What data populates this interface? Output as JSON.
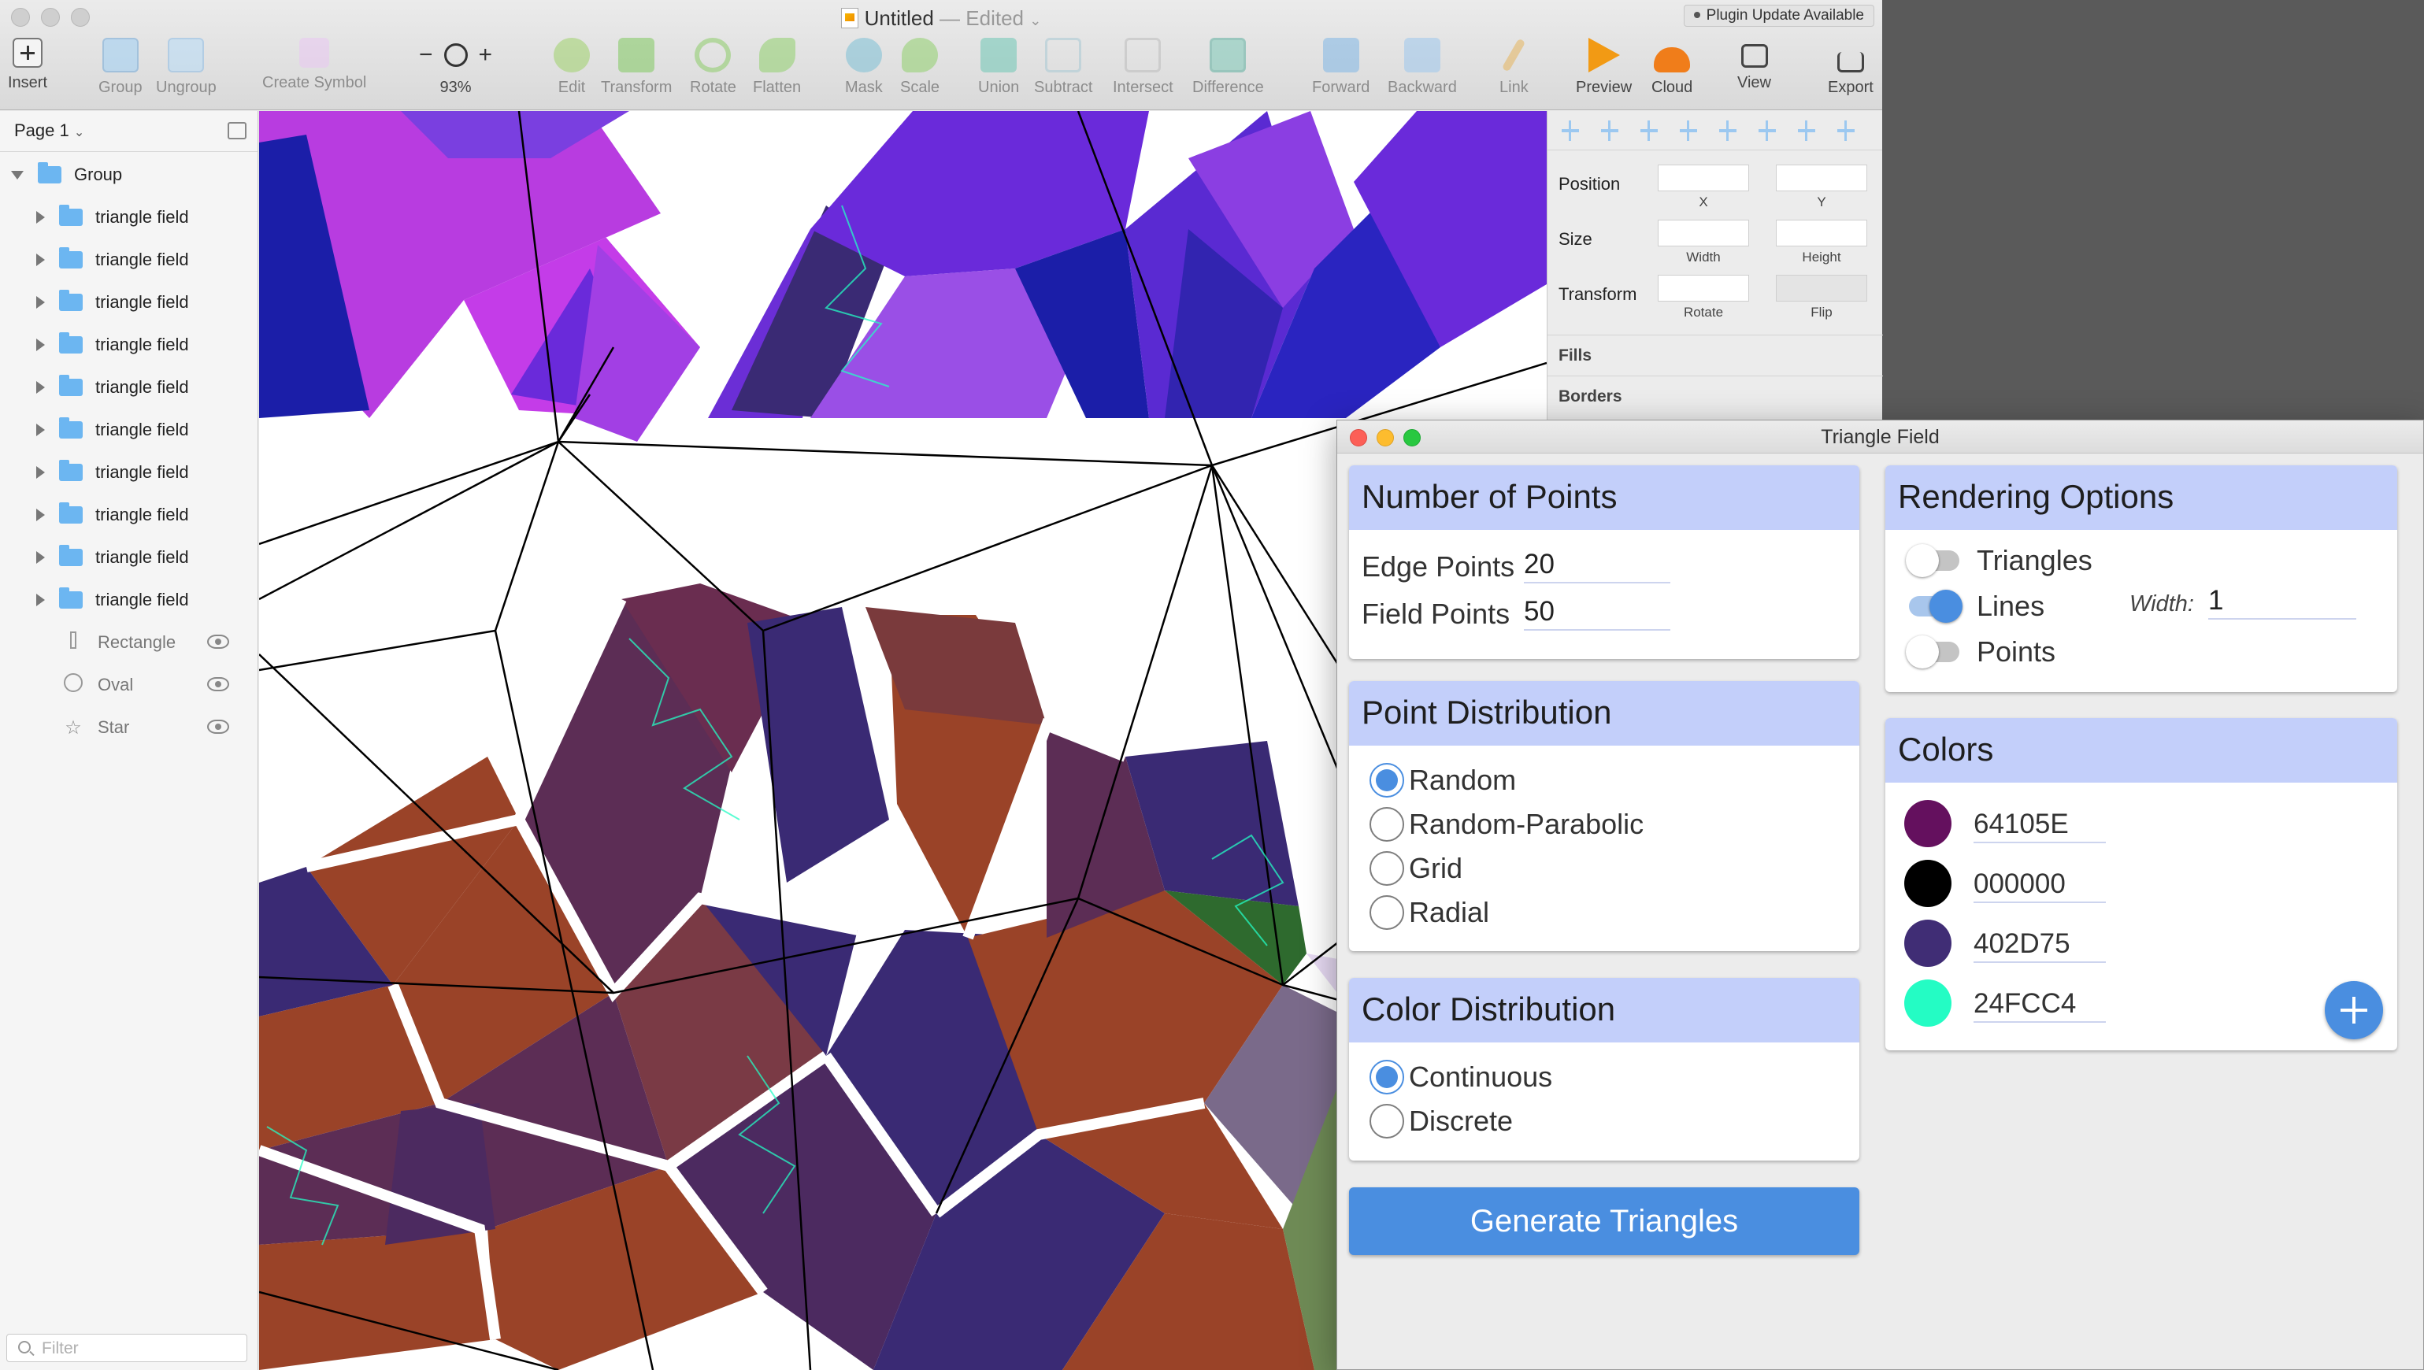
{
  "window": {
    "title": "Untitled",
    "edited": "— Edited",
    "plugin_update": "Plugin Update Available",
    "zoom": "93%"
  },
  "toolbar": [
    {
      "id": "insert",
      "label": "Insert",
      "icon": "plus-icon"
    },
    {
      "id": "group",
      "label": "Group",
      "icon": "group-icon"
    },
    {
      "id": "ungroup",
      "label": "Ungroup",
      "icon": "ungroup-icon"
    },
    {
      "id": "create-symbol",
      "label": "Create Symbol",
      "icon": "symbol-icon"
    },
    {
      "id": "edit",
      "label": "Edit",
      "icon": "edit-icon"
    },
    {
      "id": "transform",
      "label": "Transform",
      "icon": "transform-icon"
    },
    {
      "id": "rotate",
      "label": "Rotate",
      "icon": "rotate-icon"
    },
    {
      "id": "flatten",
      "label": "Flatten",
      "icon": "flatten-icon"
    },
    {
      "id": "mask",
      "label": "Mask",
      "icon": "mask-icon"
    },
    {
      "id": "scale",
      "label": "Scale",
      "icon": "scale-icon"
    },
    {
      "id": "union",
      "label": "Union",
      "icon": "union-icon"
    },
    {
      "id": "subtract",
      "label": "Subtract",
      "icon": "subtract-icon"
    },
    {
      "id": "intersect",
      "label": "Intersect",
      "icon": "intersect-icon"
    },
    {
      "id": "difference",
      "label": "Difference",
      "icon": "difference-icon"
    },
    {
      "id": "forward",
      "label": "Forward",
      "icon": "forward-icon"
    },
    {
      "id": "backward",
      "label": "Backward",
      "icon": "backward-icon"
    },
    {
      "id": "link",
      "label": "Link",
      "icon": "link-icon"
    },
    {
      "id": "preview",
      "label": "Preview",
      "icon": "preview-icon"
    },
    {
      "id": "cloud",
      "label": "Cloud",
      "icon": "cloud-icon"
    },
    {
      "id": "view",
      "label": "View",
      "icon": "view-icon"
    },
    {
      "id": "export",
      "label": "Export",
      "icon": "export-icon"
    }
  ],
  "layers": {
    "page": "Page 1",
    "group": "Group",
    "items": [
      "triangle field",
      "triangle field",
      "triangle field",
      "triangle field",
      "triangle field",
      "triangle field",
      "triangle field",
      "triangle field",
      "triangle field",
      "triangle field"
    ],
    "shapes": [
      {
        "label": "Rectangle",
        "icon": "rectangle-icon"
      },
      {
        "label": "Oval",
        "icon": "oval-icon"
      },
      {
        "label": "Star",
        "icon": "star-icon"
      }
    ],
    "filter_placeholder": "Filter"
  },
  "inspector": {
    "position": "Position",
    "x": "X",
    "y": "Y",
    "size": "Size",
    "width": "Width",
    "height": "Height",
    "transform": "Transform",
    "rotate": "Rotate",
    "flip": "Flip",
    "fills": "Fills",
    "borders": "Borders"
  },
  "plugin": {
    "title": "Triangle Field",
    "points": {
      "heading": "Number of Points",
      "edge_label": "Edge Points",
      "edge_value": "20",
      "field_label": "Field Points",
      "field_value": "50"
    },
    "point_distribution": {
      "heading": "Point Distribution",
      "options": [
        "Random",
        "Random-Parabolic",
        "Grid",
        "Radial"
      ],
      "selected": "Random"
    },
    "color_distribution": {
      "heading": "Color Distribution",
      "options": [
        "Continuous",
        "Discrete"
      ],
      "selected": "Continuous"
    },
    "rendering": {
      "heading": "Rendering Options",
      "triangles": "Triangles",
      "triangles_on": false,
      "lines": "Lines",
      "lines_on": true,
      "points": "Points",
      "points_on": false,
      "width_label": "Width:",
      "width_value": "1"
    },
    "colors": {
      "heading": "Colors",
      "values": [
        "64105E",
        "000000",
        "402D75",
        "24FCC4"
      ],
      "swatches": [
        "#64105E",
        "#000000",
        "#402D75",
        "#24FCC4"
      ]
    },
    "generate": "Generate Triangles"
  },
  "palette": {
    "accent": "#4A8EE0",
    "card_header": "#C3CFFA",
    "canvas_purple": "#B83CE0",
    "canvas_violet": "#6A2ADA",
    "canvas_navy": "#1B1EA8",
    "canvas_rust": "#9A4328",
    "canvas_plum": "#5C2D55",
    "canvas_indigo": "#3A2A74"
  }
}
